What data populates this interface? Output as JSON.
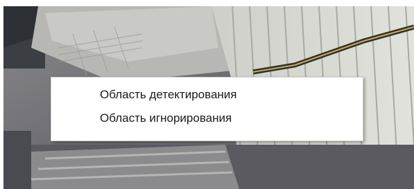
{
  "context_menu": {
    "items": [
      {
        "label": "Область детектирования"
      },
      {
        "label": "Область игнорирования"
      }
    ]
  },
  "colors": {
    "menu_background": "#ffffff",
    "menu_text": "#1a1a1a",
    "menu_border": "#cfcfcf"
  }
}
